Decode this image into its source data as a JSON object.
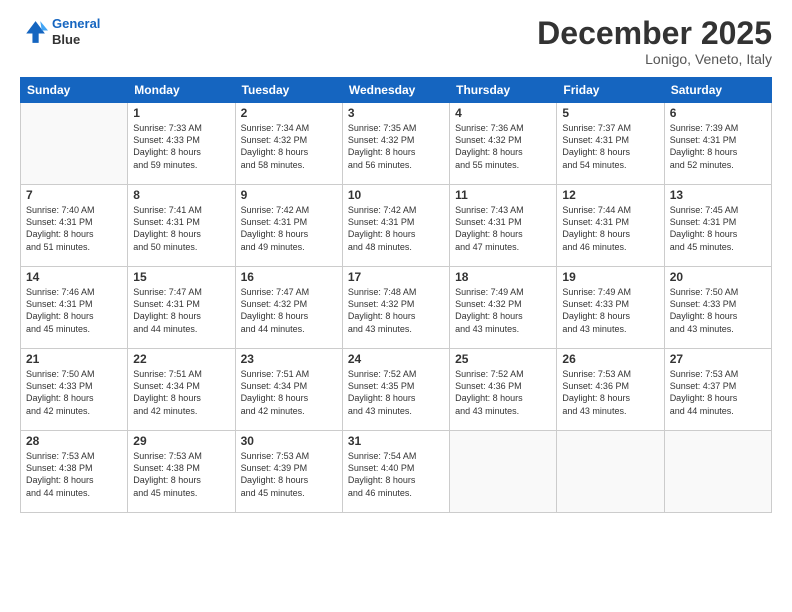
{
  "header": {
    "logo_line1": "General",
    "logo_line2": "Blue",
    "month_title": "December 2025",
    "location": "Lonigo, Veneto, Italy"
  },
  "days_of_week": [
    "Sunday",
    "Monday",
    "Tuesday",
    "Wednesday",
    "Thursday",
    "Friday",
    "Saturday"
  ],
  "weeks": [
    [
      {
        "day": "",
        "info": ""
      },
      {
        "day": "1",
        "info": "Sunrise: 7:33 AM\nSunset: 4:33 PM\nDaylight: 8 hours\nand 59 minutes."
      },
      {
        "day": "2",
        "info": "Sunrise: 7:34 AM\nSunset: 4:32 PM\nDaylight: 8 hours\nand 58 minutes."
      },
      {
        "day": "3",
        "info": "Sunrise: 7:35 AM\nSunset: 4:32 PM\nDaylight: 8 hours\nand 56 minutes."
      },
      {
        "day": "4",
        "info": "Sunrise: 7:36 AM\nSunset: 4:32 PM\nDaylight: 8 hours\nand 55 minutes."
      },
      {
        "day": "5",
        "info": "Sunrise: 7:37 AM\nSunset: 4:31 PM\nDaylight: 8 hours\nand 54 minutes."
      },
      {
        "day": "6",
        "info": "Sunrise: 7:39 AM\nSunset: 4:31 PM\nDaylight: 8 hours\nand 52 minutes."
      }
    ],
    [
      {
        "day": "7",
        "info": "Sunrise: 7:40 AM\nSunset: 4:31 PM\nDaylight: 8 hours\nand 51 minutes."
      },
      {
        "day": "8",
        "info": "Sunrise: 7:41 AM\nSunset: 4:31 PM\nDaylight: 8 hours\nand 50 minutes."
      },
      {
        "day": "9",
        "info": "Sunrise: 7:42 AM\nSunset: 4:31 PM\nDaylight: 8 hours\nand 49 minutes."
      },
      {
        "day": "10",
        "info": "Sunrise: 7:42 AM\nSunset: 4:31 PM\nDaylight: 8 hours\nand 48 minutes."
      },
      {
        "day": "11",
        "info": "Sunrise: 7:43 AM\nSunset: 4:31 PM\nDaylight: 8 hours\nand 47 minutes."
      },
      {
        "day": "12",
        "info": "Sunrise: 7:44 AM\nSunset: 4:31 PM\nDaylight: 8 hours\nand 46 minutes."
      },
      {
        "day": "13",
        "info": "Sunrise: 7:45 AM\nSunset: 4:31 PM\nDaylight: 8 hours\nand 45 minutes."
      }
    ],
    [
      {
        "day": "14",
        "info": "Sunrise: 7:46 AM\nSunset: 4:31 PM\nDaylight: 8 hours\nand 45 minutes."
      },
      {
        "day": "15",
        "info": "Sunrise: 7:47 AM\nSunset: 4:31 PM\nDaylight: 8 hours\nand 44 minutes."
      },
      {
        "day": "16",
        "info": "Sunrise: 7:47 AM\nSunset: 4:32 PM\nDaylight: 8 hours\nand 44 minutes."
      },
      {
        "day": "17",
        "info": "Sunrise: 7:48 AM\nSunset: 4:32 PM\nDaylight: 8 hours\nand 43 minutes."
      },
      {
        "day": "18",
        "info": "Sunrise: 7:49 AM\nSunset: 4:32 PM\nDaylight: 8 hours\nand 43 minutes."
      },
      {
        "day": "19",
        "info": "Sunrise: 7:49 AM\nSunset: 4:33 PM\nDaylight: 8 hours\nand 43 minutes."
      },
      {
        "day": "20",
        "info": "Sunrise: 7:50 AM\nSunset: 4:33 PM\nDaylight: 8 hours\nand 43 minutes."
      }
    ],
    [
      {
        "day": "21",
        "info": "Sunrise: 7:50 AM\nSunset: 4:33 PM\nDaylight: 8 hours\nand 42 minutes."
      },
      {
        "day": "22",
        "info": "Sunrise: 7:51 AM\nSunset: 4:34 PM\nDaylight: 8 hours\nand 42 minutes."
      },
      {
        "day": "23",
        "info": "Sunrise: 7:51 AM\nSunset: 4:34 PM\nDaylight: 8 hours\nand 42 minutes."
      },
      {
        "day": "24",
        "info": "Sunrise: 7:52 AM\nSunset: 4:35 PM\nDaylight: 8 hours\nand 43 minutes."
      },
      {
        "day": "25",
        "info": "Sunrise: 7:52 AM\nSunset: 4:36 PM\nDaylight: 8 hours\nand 43 minutes."
      },
      {
        "day": "26",
        "info": "Sunrise: 7:53 AM\nSunset: 4:36 PM\nDaylight: 8 hours\nand 43 minutes."
      },
      {
        "day": "27",
        "info": "Sunrise: 7:53 AM\nSunset: 4:37 PM\nDaylight: 8 hours\nand 44 minutes."
      }
    ],
    [
      {
        "day": "28",
        "info": "Sunrise: 7:53 AM\nSunset: 4:38 PM\nDaylight: 8 hours\nand 44 minutes."
      },
      {
        "day": "29",
        "info": "Sunrise: 7:53 AM\nSunset: 4:38 PM\nDaylight: 8 hours\nand 45 minutes."
      },
      {
        "day": "30",
        "info": "Sunrise: 7:53 AM\nSunset: 4:39 PM\nDaylight: 8 hours\nand 45 minutes."
      },
      {
        "day": "31",
        "info": "Sunrise: 7:54 AM\nSunset: 4:40 PM\nDaylight: 8 hours\nand 46 minutes."
      },
      {
        "day": "",
        "info": ""
      },
      {
        "day": "",
        "info": ""
      },
      {
        "day": "",
        "info": ""
      }
    ]
  ]
}
